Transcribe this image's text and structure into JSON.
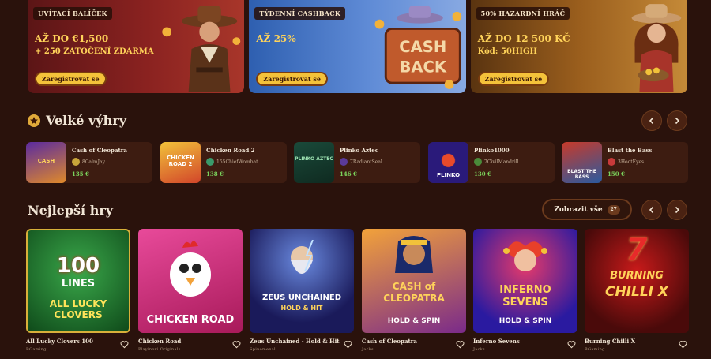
{
  "banners": [
    {
      "tag": "UVÍTACÍ BALÍČEK",
      "line1": "AŽ DO €1,500",
      "line2": "+ 250 ZATOČENÍ ZDARMA",
      "cta": "Zaregistrovat se"
    },
    {
      "tag": "TÝDENNÍ CASHBACK",
      "line1": "AŽ 25%",
      "line2": "",
      "cta": "Zaregistrovat se",
      "art_text_1": "CASH",
      "art_text_2": "BACK"
    },
    {
      "tag": "50% HAZARDNÍ HRÁČ",
      "line1": "AŽ DO 12 500 KČ",
      "line2": "Kód: 50HIGH",
      "cta": "Zaregistrovat se"
    }
  ],
  "big_wins": {
    "title": "Velké výhry",
    "items": [
      {
        "game": "Cash of Cleopatra",
        "user": "8CalmJay",
        "amount": "135 €"
      },
      {
        "game": "Chicken Road 2",
        "user": "155ChiefWombat",
        "amount": "138 €"
      },
      {
        "game": "Plinko Aztec",
        "user": "7RadiantSeal",
        "amount": "146 €"
      },
      {
        "game": "Plinko1000",
        "user": "7CivilMandrill",
        "amount": "130 €"
      },
      {
        "game": "Blast the Bass",
        "user": "3HootEyes",
        "amount": "150 €"
      }
    ],
    "thumb_texts": [
      "CASH",
      "CHICKEN ROAD 2",
      "PLINKO AZTEC",
      "PLINKO",
      "BLAST THE BASS"
    ]
  },
  "top_games": {
    "title": "Nejlepší hry",
    "view_all_label": "Zobrazit vše",
    "view_all_count": "27",
    "items": [
      {
        "title": "All Lucky Clovers 100",
        "provider": "BGaming",
        "tile_top": "100",
        "tile_mid": "LINES",
        "tile_bottom": "ALL LUCKY CLOVERS"
      },
      {
        "title": "Chicken Road",
        "provider": "Playinovi Originals",
        "tile_top": "",
        "tile_mid": "",
        "tile_bottom": "CHICKEN ROAD"
      },
      {
        "title": "Zeus Unchained - Hold & Hit",
        "provider": "Spinomenal",
        "tile_top": "",
        "tile_mid": "ZEUS UNCHAINED",
        "tile_bottom": "HOLD & HIT"
      },
      {
        "title": "Cash of Cleopatra",
        "provider": "Jacks",
        "tile_top": "",
        "tile_mid": "CASH of CLEOPATRA",
        "tile_bottom": "HOLD & SPIN"
      },
      {
        "title": "Inferno Sevens",
        "provider": "Jacks",
        "tile_top": "",
        "tile_mid": "INFERNO SEVENS",
        "tile_bottom": "HOLD & SPIN"
      },
      {
        "title": "Burning Chilli X",
        "provider": "BGaming",
        "tile_top": "7",
        "tile_mid": "BURNING",
        "tile_bottom": "CHILLI X"
      }
    ]
  },
  "colors": {
    "background": "#2a120c",
    "accent_yellow": "#f4c23a",
    "win_green": "#7bd35c"
  },
  "icons": {
    "section_star": "star-icon",
    "prev": "chevron-left-icon",
    "next": "chevron-right-icon",
    "favorite": "heart-icon"
  }
}
